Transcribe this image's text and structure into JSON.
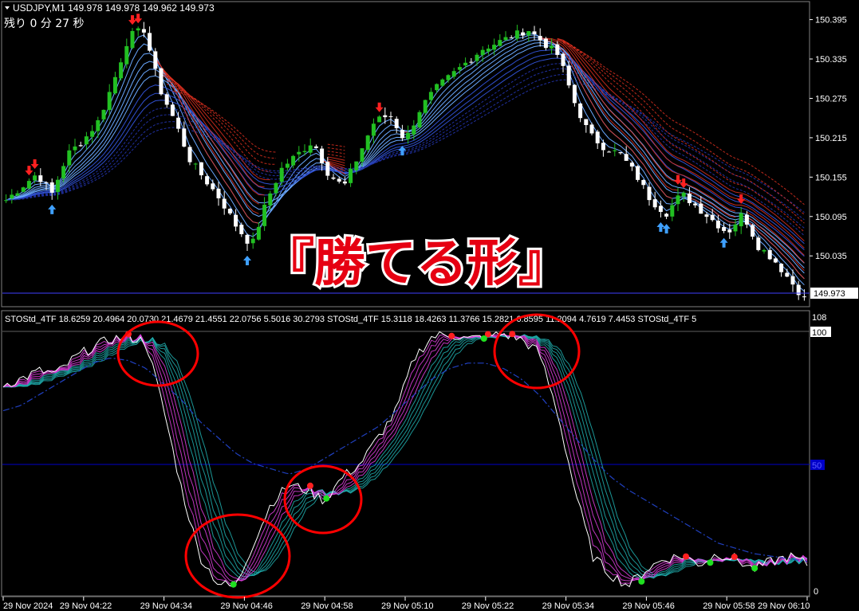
{
  "main_header": {
    "symbol_line": "USDJPY,M1  149.978 149.978 149.962 149.973",
    "timer": "残り 0 分 27 秒"
  },
  "overlay_text": "『勝てる形』",
  "indicator_header": "STOStd_4TF 18.6259 20.4964 20.0730 21.4679 21.4551 22.0756 5.5016 30.2793  STOStd_4TF 15.3118 18.4263 11.3766 15.2821 6.8595 11.2094 4.7619 7.4453  STOStd_4TF 5",
  "colors": {
    "background": "#000000",
    "grid": "#3a3a3a",
    "bull_candle": "#22c022",
    "bear_candle": "#ffffff",
    "up_arrow": "#3fa0ff",
    "down_arrow": "#ff2020",
    "ribbon_blue": "#6aa8ff",
    "ribbon_red": "#e03020",
    "stoch_magenta": "#e040e0",
    "stoch_teal": "#20b0b0",
    "level_line": "#0000c8",
    "circle": "#ff0000",
    "overlay_red": "#e60012"
  },
  "chart_data": [
    {
      "type": "candlestick",
      "title": "USDJPY,M1",
      "y_ticks": [
        "150.395",
        "150.335",
        "150.275",
        "150.215",
        "150.155",
        "150.095",
        "150.035"
      ],
      "ylim": [
        150.0,
        150.42
      ],
      "last_price": "149.973",
      "x_labels": [
        "29 Nov 2024",
        "29 Nov 04:22",
        "29 Nov 04:34",
        "29 Nov 04:46",
        "29 Nov 04:58",
        "29 Nov 05:10",
        "29 Nov 05:22",
        "29 Nov 05:34",
        "29 Nov 05:46",
        "29 Nov 05:58",
        "29 Nov 06:10"
      ],
      "close_path": [
        150.12,
        150.14,
        150.16,
        150.13,
        150.19,
        150.21,
        150.24,
        150.3,
        150.37,
        150.38,
        150.29,
        150.24,
        150.18,
        150.15,
        150.12,
        150.08,
        150.05,
        150.12,
        150.17,
        150.19,
        150.21,
        150.16,
        150.14,
        150.19,
        150.24,
        150.25,
        150.21,
        150.26,
        150.29,
        150.31,
        150.33,
        150.35,
        150.36,
        150.37,
        150.38,
        150.36,
        150.34,
        150.27,
        150.22,
        150.2,
        150.19,
        150.16,
        150.12,
        150.1,
        150.13,
        150.11,
        150.09,
        150.07,
        150.1,
        150.05,
        150.03,
        150.0,
        149.97
      ]
    },
    {
      "type": "line",
      "title": "STOStd_4TF",
      "y_ticks": [
        "100",
        "50",
        "0"
      ],
      "y_top_label": "108",
      "ylim": [
        0,
        108
      ],
      "levels": [
        100,
        50,
        0
      ],
      "series": [
        {
          "values": [
            80,
            82,
            85,
            84,
            90,
            94,
            97,
            98,
            96,
            70,
            40,
            15,
            5,
            3,
            20,
            35,
            42,
            40,
            36,
            45,
            50,
            60,
            70,
            90,
            98,
            99,
            97,
            98,
            99,
            97,
            92,
            70,
            40,
            15,
            8,
            4,
            10,
            14,
            15,
            12,
            16,
            14,
            10,
            13,
            15,
            12
          ]
        }
      ],
      "slow_line": [
        70,
        72,
        76,
        80,
        84,
        88,
        90,
        89,
        86,
        80,
        74,
        66,
        60,
        54,
        50,
        48,
        46,
        48,
        52,
        56,
        60,
        64,
        70,
        76,
        82,
        86,
        88,
        88,
        86,
        82,
        76,
        68,
        60,
        52,
        45,
        40,
        36,
        32,
        28,
        24,
        20,
        18,
        16,
        15,
        14,
        13
      ]
    }
  ]
}
